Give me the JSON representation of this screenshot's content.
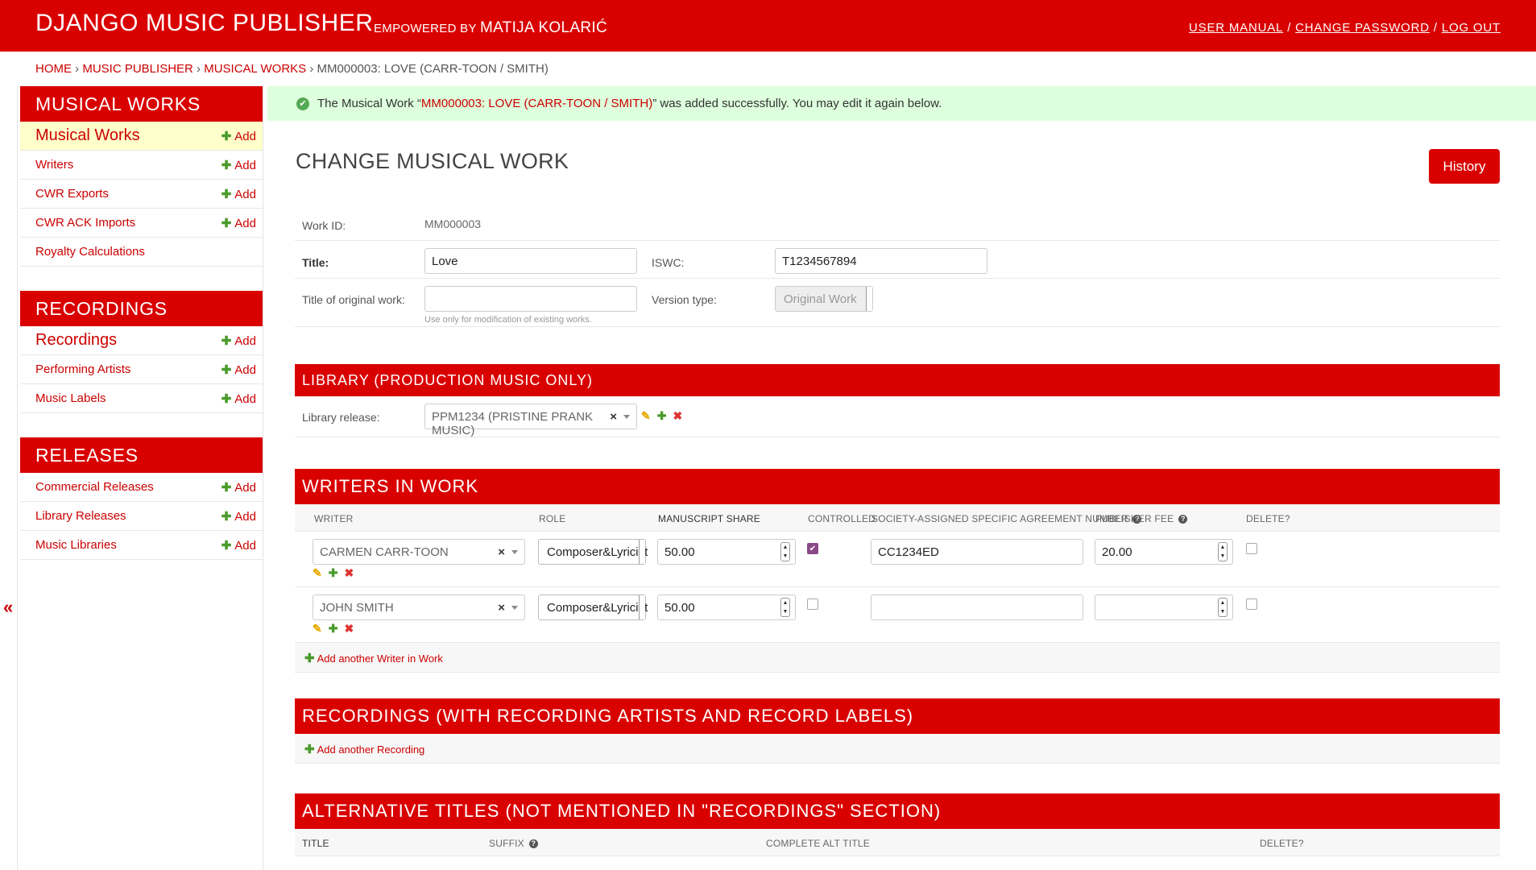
{
  "header": {
    "branding": "DJANGO MUSIC PUBLISHER",
    "empowered_prefix": "EMPOWERED BY",
    "empowered_name": "MATIJA KOLARIĆ",
    "user_manual": "USER MANUAL",
    "change_password": "CHANGE PASSWORD",
    "log_out": "LOG OUT",
    "separator": "/"
  },
  "breadcrumbs": {
    "home": "HOME",
    "app": "MUSIC PUBLISHER",
    "model": "MUSICAL WORKS",
    "current": "MM000003: LOVE (CARR-TOON / SMITH)",
    "sep": "›"
  },
  "sidebar": {
    "collapse_icon": "«",
    "add_label": "Add",
    "modules": [
      {
        "title": "MUSICAL WORKS",
        "items": [
          {
            "label": "Musical Works",
            "has_add": true
          },
          {
            "label": "Writers",
            "has_add": true
          },
          {
            "label": "CWR Exports",
            "has_add": true
          },
          {
            "label": "CWR ACK Imports",
            "has_add": true
          },
          {
            "label": "Royalty Calculations",
            "has_add": false
          }
        ]
      },
      {
        "title": "RECORDINGS",
        "items": [
          {
            "label": "Recordings",
            "has_add": true
          },
          {
            "label": "Performing Artists",
            "has_add": true
          },
          {
            "label": "Music Labels",
            "has_add": true
          }
        ]
      },
      {
        "title": "RELEASES",
        "items": [
          {
            "label": "Commercial Releases",
            "has_add": true
          },
          {
            "label": "Library Releases",
            "has_add": true
          },
          {
            "label": "Music Libraries",
            "has_add": true
          }
        ]
      }
    ]
  },
  "message": {
    "prefix": "The Musical Work “",
    "link": "MM000003: LOVE (CARR-TOON / SMITH)",
    "suffix": "” was added successfully. You may edit it again below."
  },
  "page": {
    "title": "CHANGE MUSICAL WORK",
    "history_button": "History"
  },
  "form": {
    "work_id_label": "Work ID:",
    "work_id_value": "MM000003",
    "title_label": "Title:",
    "title_value": "Love",
    "iswc_label": "ISWC:",
    "iswc_value": "T1234567894",
    "original_title_label": "Title of original work:",
    "original_title_value": "",
    "original_title_help": "Use only for modification of existing works.",
    "version_type_label": "Version type:",
    "version_type_value": "Original Work"
  },
  "library": {
    "header": "LIBRARY (PRODUCTION MUSIC ONLY)",
    "release_label": "Library release:",
    "release_value": "PPM1234 (PRISTINE PRANK MUSIC)",
    "clear": "×"
  },
  "writers": {
    "header": "WRITERS IN WORK",
    "columns": {
      "writer": "WRITER",
      "role": "ROLE",
      "share": "MANUSCRIPT SHARE",
      "controlled": "CONTROLLED",
      "san": "SOCIETY-ASSIGNED SPECIFIC AGREEMENT NUMBER",
      "fee": "PUBLISHER FEE",
      "delete": "DELETE?"
    },
    "rows": [
      {
        "writer": "CARMEN CARR-TOON",
        "role": "Composer&Lyricist",
        "share": "50.00",
        "controlled": true,
        "san": "CC1234ED",
        "fee": "20.00"
      },
      {
        "writer": "JOHN SMITH",
        "role": "Composer&Lyricist",
        "share": "50.00",
        "controlled": false,
        "san": "",
        "fee": ""
      }
    ],
    "add_another": "Add another Writer in Work"
  },
  "recordings": {
    "header": "RECORDINGS (WITH RECORDING ARTISTS AND RECORD LABELS)",
    "add_another": "Add another Recording"
  },
  "alt_titles": {
    "header": "ALTERNATIVE TITLES (NOT MENTIONED IN \"RECORDINGS\" SECTION)",
    "columns": {
      "title": "TITLE",
      "suffix": "SUFFIX",
      "complete": "COMPLETE ALT TITLE",
      "delete": "DELETE?"
    }
  },
  "colors": {
    "brand": "#d90000",
    "link": "#cc0000",
    "success_bg": "#ddffdd",
    "active_bg": "#ffffcc",
    "add_green": "#4a9a2c"
  }
}
